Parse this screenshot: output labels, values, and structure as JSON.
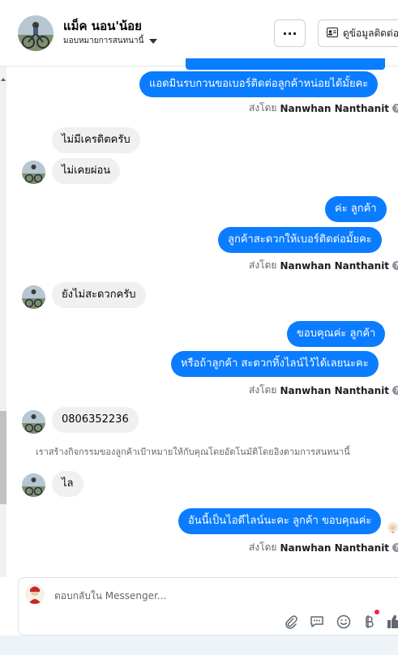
{
  "header": {
    "contact_name": "แม็ค นอน'น้อย",
    "assign_label": "มอบหมายการสนทนานี้",
    "more_label": "···",
    "info_label": "ดูข้อมูลติดต่อ"
  },
  "messages": {
    "m1": "แอดมินรบกวนขอเบอร์ติดต่อลูกค้าหน่อยได้มั้ยคะ",
    "m2": "ไม่มีเครดิตครับ",
    "m3": "ไม่เคยผ่อน",
    "m4": "ค่ะ ลูกค้า",
    "m5": "ลูกค้าสะดวกให้เบอร์ติดต่อมั้ยคะ",
    "m6": "ยังไม่สะดวกครับ",
    "m7": "ขอบคุณค่ะ ลูกค้า",
    "m8": "หรือถ้าลูกค้า สะดวกทิ้งไลน์ไว้ได้เลยนะคะ",
    "m9": "0806352236",
    "m10": "ไล",
    "m11": "อันนี้เป็นไอดีไลน์นะคะ ลูกค้า ขอบคุณค่ะ"
  },
  "sent_by": {
    "prefix": "ส่งโดย",
    "name": "Nanwhan Nanthanit"
  },
  "notice": "เราสร้างกิจกรรมของลูกค้าเป้าหมายให้กับคุณโดยอัตโนมัติโดยอิงตามการสนทนานี้",
  "composer": {
    "placeholder": "ตอบกลับใน Messenger..."
  },
  "colors": {
    "outgoing_bubble": "#0a7cff",
    "incoming_bubble": "#f0f0f0",
    "notification_dot": "#f02849"
  },
  "icons": {
    "toolbar": [
      "paperclip-icon",
      "chat-bubble-icon",
      "emoji-icon",
      "baht-icon",
      "like-icon"
    ]
  }
}
